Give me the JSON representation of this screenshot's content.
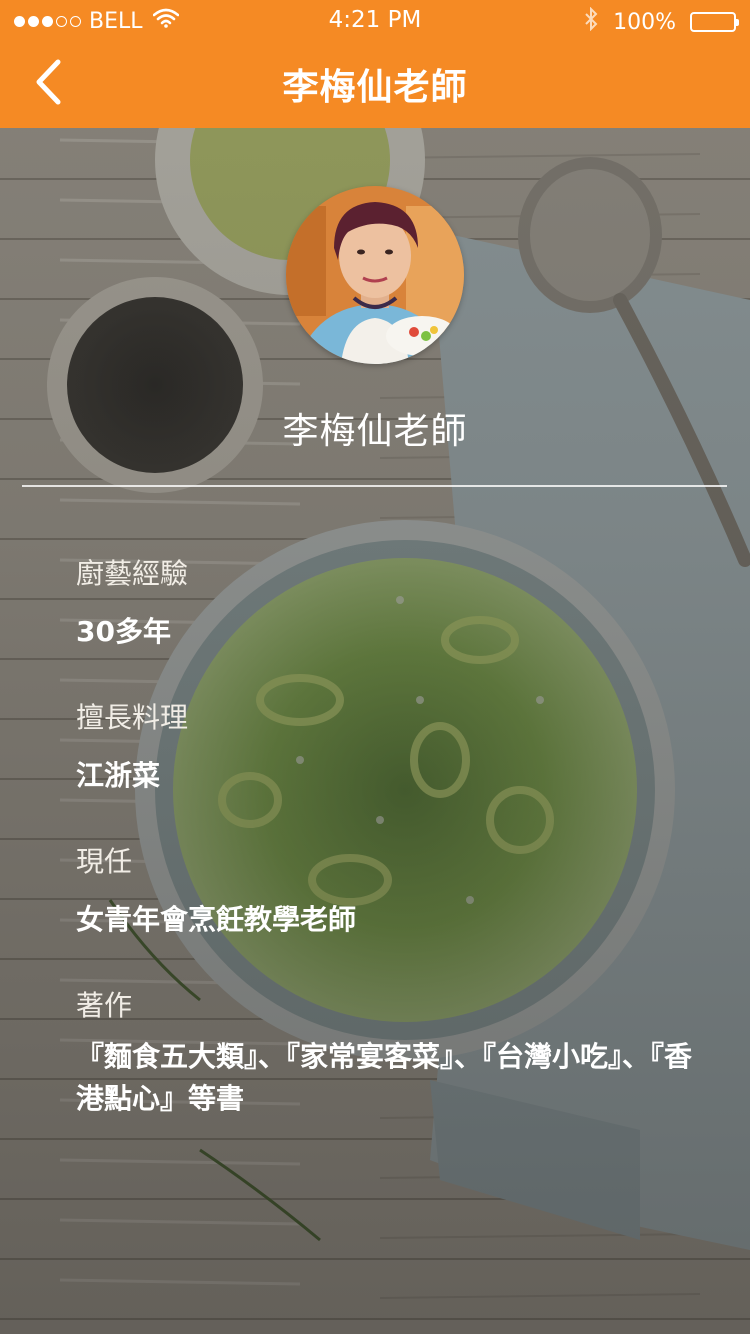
{
  "status_bar": {
    "carrier": "BELL",
    "time": "4:21 PM",
    "battery": "100%"
  },
  "nav": {
    "title": "李梅仙老師"
  },
  "profile": {
    "name": "李梅仙老師"
  },
  "details": [
    {
      "label": "廚藝經驗",
      "value": "30多年"
    },
    {
      "label": "擅長料理",
      "value": "江浙菜"
    },
    {
      "label": "現任",
      "value": "女青年會烹飪教學老師"
    },
    {
      "label": "著作",
      "value": "『麵食五大類』、『家常宴客菜』、『台灣小吃』、『香港點心』等書"
    }
  ],
  "colors": {
    "nav_bar": "#f58a24",
    "text": "#ffffff"
  },
  "icons": [
    "wifi-icon",
    "bluetooth-icon",
    "battery-icon",
    "back-chevron-icon"
  ]
}
